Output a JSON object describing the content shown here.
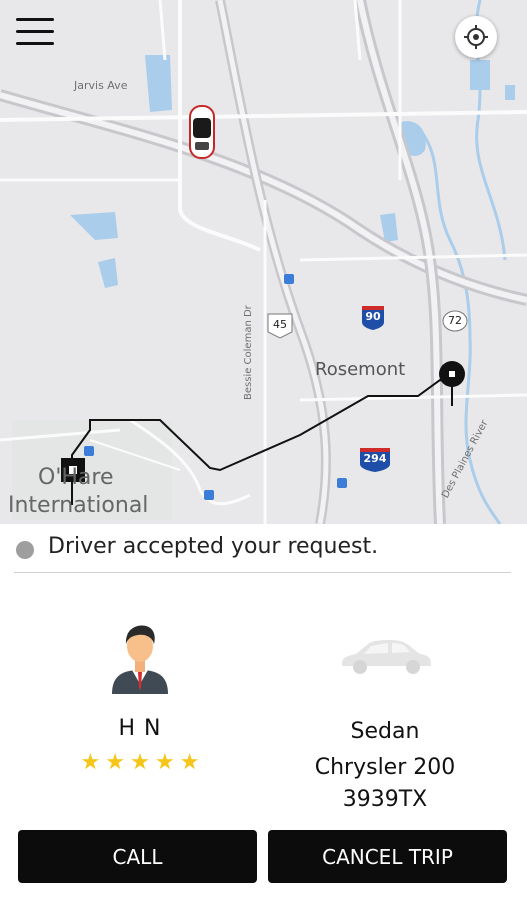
{
  "map": {
    "labels": {
      "jarvis_ave": "Jarvis Ave",
      "rosemont": "Rosemont",
      "ohare_line1": "O'Hare",
      "ohare_line2": "International",
      "bessie_coleman": "Bessie Coleman Dr",
      "des_plaines": "Des Plaines River"
    },
    "shields": {
      "us45": "45",
      "i90": "90",
      "i294": "294",
      "rt72": "72"
    }
  },
  "status": {
    "text": "Driver accepted your request."
  },
  "driver": {
    "name": "H N",
    "rating": 5
  },
  "vehicle": {
    "type": "Sedan",
    "model": "Chrysler 200",
    "plate": "3939TX"
  },
  "actions": {
    "call_label": "CALL",
    "cancel_label": "CANCEL TRIP"
  },
  "colors": {
    "button_bg": "#0c0c0c",
    "star": "#f5c518",
    "status_dot": "#9e9e9e",
    "water": "#a9cdea",
    "interstate": "#1f4ea8"
  }
}
